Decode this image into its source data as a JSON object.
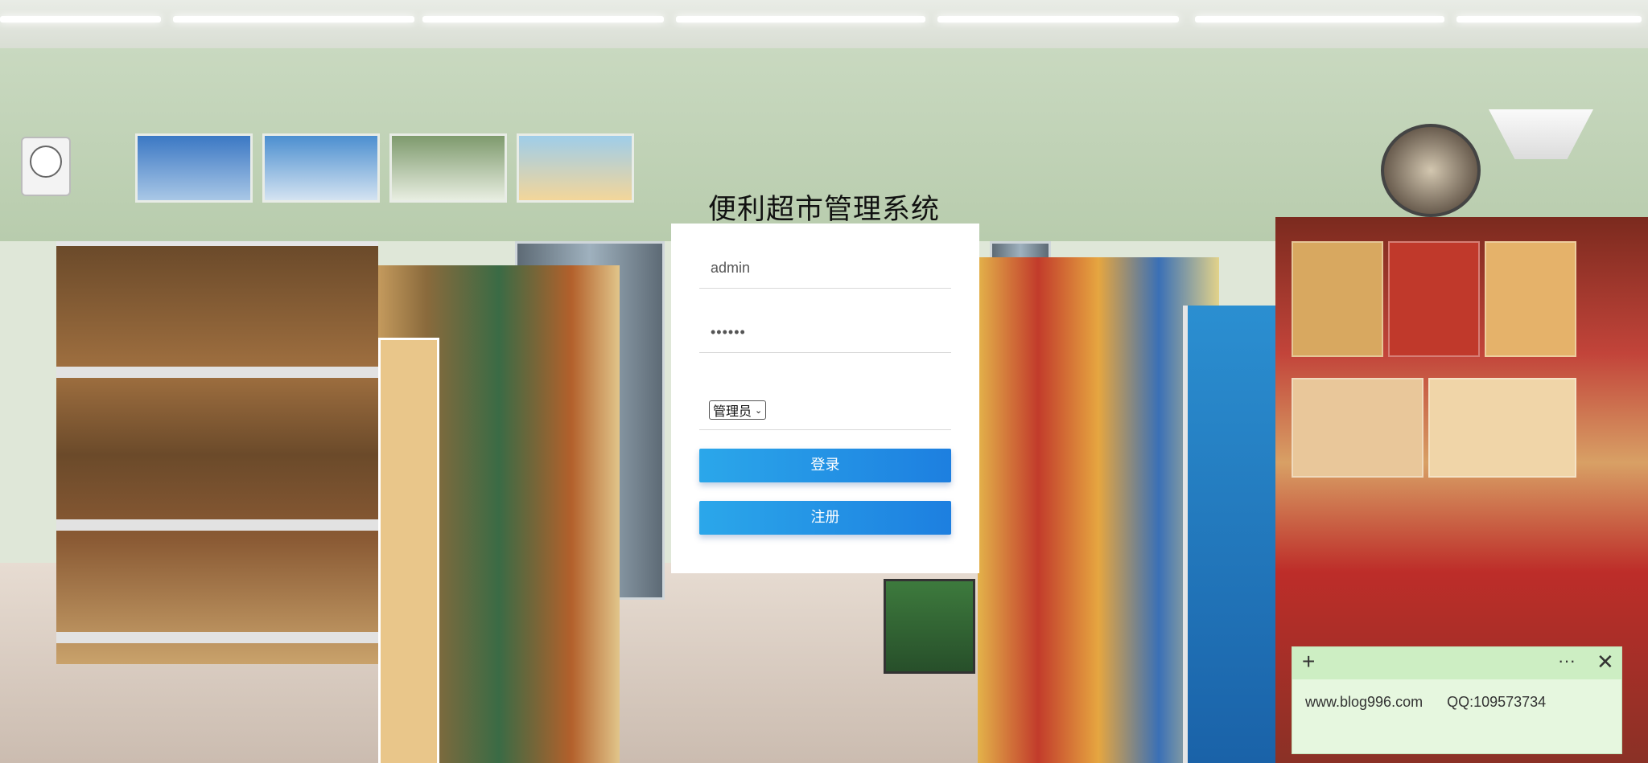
{
  "app": {
    "title": "便利超市管理系统"
  },
  "login": {
    "username_value": "admin",
    "password_value": "••••••",
    "role_selected": "管理员",
    "login_button": "登录",
    "register_button": "注册"
  },
  "note_widget": {
    "text": "www.blog996.com      QQ:109573734",
    "plus_icon": "plus-icon",
    "more_icon": "more-icon",
    "close_icon": "close-icon"
  },
  "colors": {
    "button_start": "#2ba7ea",
    "button_end": "#1d7fe0",
    "note_bg": "#e6f7df",
    "note_bar": "#cdeec3"
  }
}
